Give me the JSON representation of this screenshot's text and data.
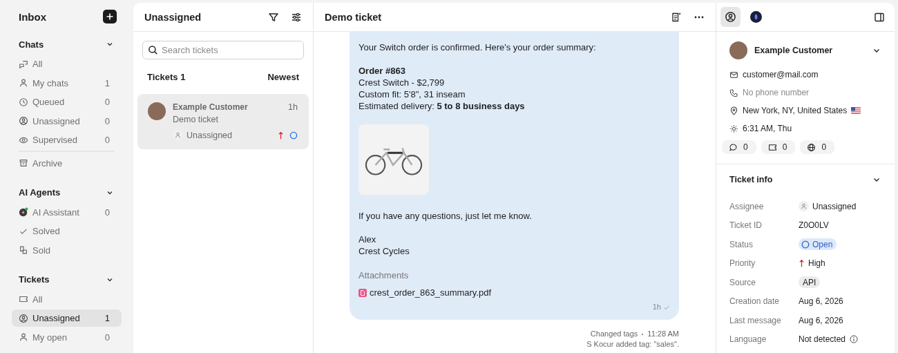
{
  "sidebar": {
    "title": "Inbox",
    "sections": [
      {
        "title": "Chats",
        "expanded": true,
        "items": [
          {
            "label": "All",
            "selected": false
          },
          {
            "label": "My chats",
            "count": "1",
            "selected": false
          },
          {
            "label": "Queued",
            "count": "0",
            "selected": false
          },
          {
            "label": "Unassigned",
            "count": "0",
            "selected": false
          },
          {
            "label": "Supervised",
            "count": "0",
            "selected": false
          }
        ],
        "extra_items": [
          {
            "label": "Archive",
            "selected": false
          }
        ]
      },
      {
        "title": "AI Agents",
        "expanded": true,
        "items": [
          {
            "label": "AI Assistant",
            "count": "0",
            "selected": false,
            "online": true
          },
          {
            "label": "Solved",
            "selected": false
          },
          {
            "label": "Sold",
            "selected": false
          }
        ]
      },
      {
        "title": "Tickets",
        "expanded": true,
        "items": [
          {
            "label": "All",
            "selected": false
          },
          {
            "label": "Unassigned",
            "count": "1",
            "selected": true
          },
          {
            "label": "My open",
            "count": "0",
            "selected": false
          }
        ]
      }
    ]
  },
  "ticket_list": {
    "title": "Unassigned",
    "search": {
      "placeholder": "Search tickets"
    },
    "count_label": "Tickets 1",
    "sort": "Newest",
    "tickets": [
      {
        "name": "Example Customer",
        "subject": "Demo ticket",
        "time": "1h",
        "assignee": "Unassigned",
        "high_priority": true,
        "open": true,
        "selected": true
      }
    ]
  },
  "conversation": {
    "title": "Demo ticket",
    "message": {
      "intro": "Your Switch order is confirmed. Here's your order summary:",
      "order_title": "Order #863",
      "order_lines": [
        "Crest Switch - $2,799",
        "Custom fit: 5'8\", 31 inseam",
        "Estimated delivery: **5 to 8 business days**"
      ],
      "closing": "If you have any questions, just let me know.",
      "signature": [
        "Alex",
        "Crest Cycles"
      ],
      "attachments_label": "Attachments",
      "attachments": [
        "crest_order_863_summary.pdf"
      ],
      "time": "1h",
      "read": true
    },
    "event": {
      "title": "Changed tags",
      "time": "11:28 AM",
      "detail": "S Kocur added tag: \"sales\"."
    }
  },
  "details": {
    "tabs": [
      {
        "kind": "contact",
        "selected": true
      },
      {
        "kind": "ai",
        "selected": false
      }
    ],
    "customer": {
      "name": "Example Customer",
      "expanded": true,
      "email": "customer@mail.com",
      "phone": "No phone number",
      "phone_missing": true,
      "location": "New York, NY, United States",
      "local_time": "6:31 AM, Thu",
      "counters": [
        {
          "kind": "chats",
          "value": "0"
        },
        {
          "kind": "tickets",
          "value": "0"
        },
        {
          "kind": "visits",
          "value": "0"
        }
      ]
    },
    "ticket_info": {
      "title": "Ticket info",
      "expanded": true,
      "rows": [
        {
          "label": "Assignee",
          "value": "Unassigned",
          "kind": "assignee"
        },
        {
          "label": "Ticket ID",
          "value": "Z0O0LV",
          "kind": "text"
        },
        {
          "label": "Status",
          "value": "Open",
          "kind": "status"
        },
        {
          "label": "Priority",
          "value": "High",
          "kind": "priority"
        },
        {
          "label": "Source",
          "value": "API",
          "kind": "tag"
        },
        {
          "label": "Creation date",
          "value": "Aug 6, 2026",
          "kind": "text"
        },
        {
          "label": "Last message",
          "value": "Aug 6, 2026",
          "kind": "text"
        },
        {
          "label": "Language",
          "value": "Not detected",
          "kind": "info"
        }
      ]
    }
  }
}
